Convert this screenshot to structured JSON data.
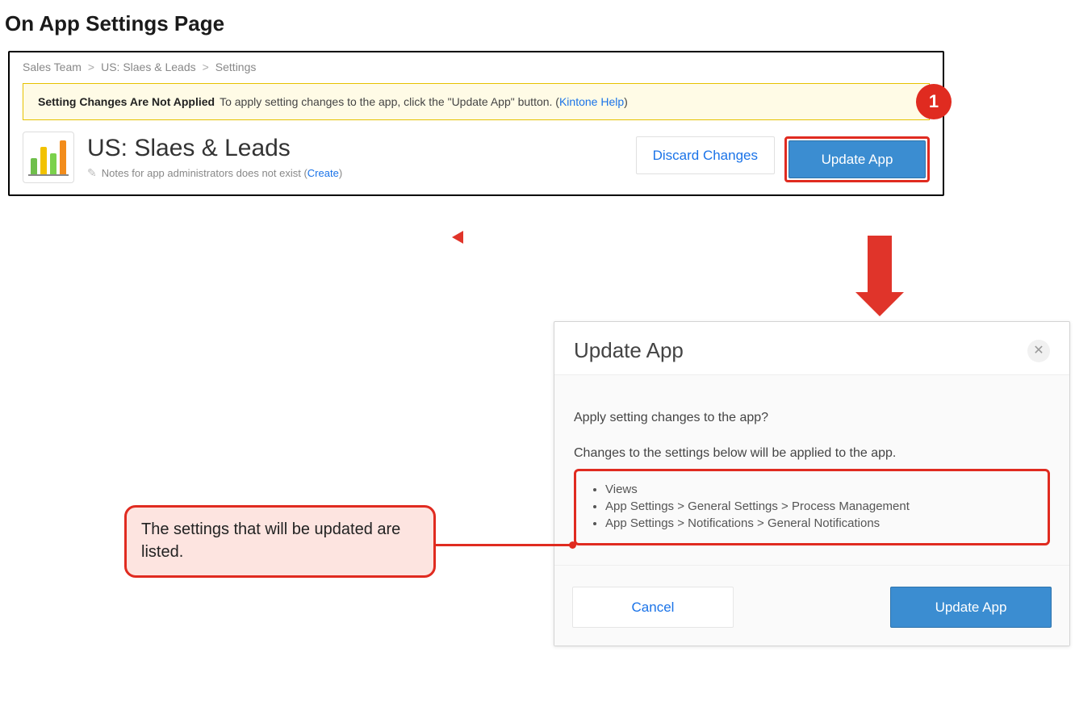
{
  "heading": "On App Settings Page",
  "breadcrumb": {
    "items": [
      "Sales Team",
      "US: Slaes & Leads",
      "Settings"
    ],
    "separator": ">"
  },
  "banner": {
    "title": "Setting Changes Are Not Applied",
    "body_prefix": "To apply setting changes to the app, click the \"Update App\" button. (",
    "link": "Kintone Help",
    "body_suffix": ")"
  },
  "step_badge": "1",
  "app": {
    "title": "US: Slaes & Leads",
    "notes_text": "Notes for app administrators does not exist (",
    "notes_link": "Create",
    "notes_suffix": ")"
  },
  "actions": {
    "discard": "Discard Changes",
    "update": "Update App"
  },
  "modal": {
    "title": "Update App",
    "prompt": "Apply setting changes to the app?",
    "info": "Changes to the settings below will be applied to the app.",
    "changes": [
      "Views",
      "App Settings > General Settings > Process Management",
      "App Settings > Notifications > General Notifications"
    ],
    "cancel": "Cancel",
    "confirm": "Update App"
  },
  "callout": "The settings that will be updated are listed.",
  "colors": {
    "accent_red": "#e02b20",
    "primary_blue": "#3b8dd1",
    "link_blue": "#1a73e8",
    "banner_bg": "#fffbe6",
    "banner_border": "#e6c200",
    "callout_bg": "#fde4e0"
  }
}
